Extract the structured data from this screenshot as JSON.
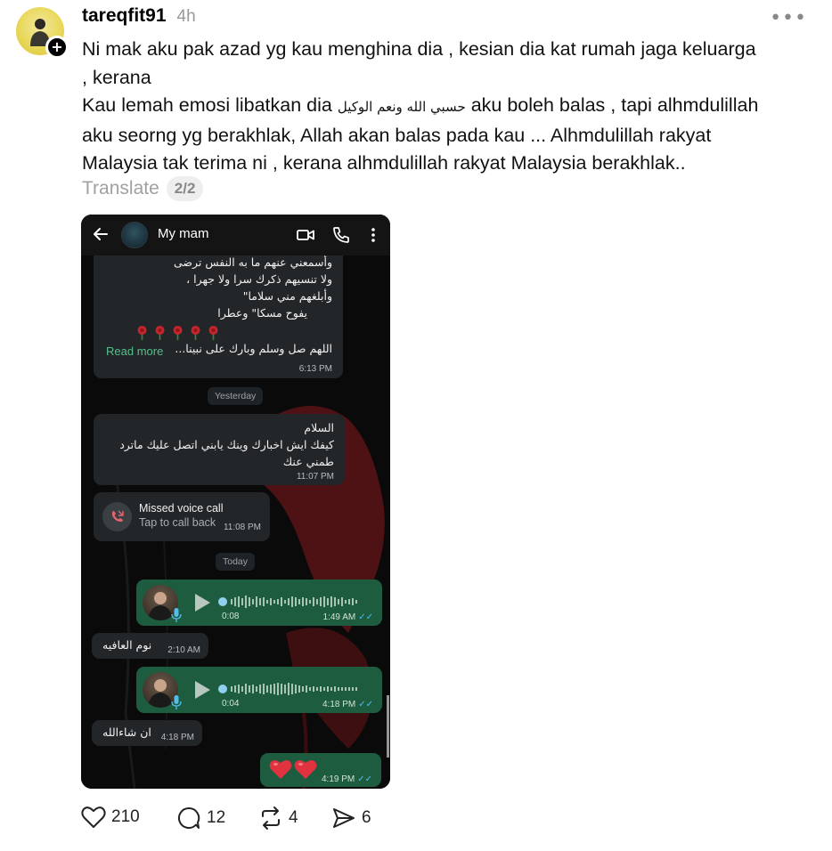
{
  "post": {
    "username": "tareqfit91",
    "time": "4h",
    "more_label": "•••",
    "follow_label": "+",
    "caption": {
      "line1": "Ni mak aku pak azad yg kau menghina dia , kesian dia kat rumah jaga keluarga",
      "line2": ", kerana",
      "line3_start": "Kau lemah emosi libatkan dia ",
      "line3_arabic": "حسبي الله ونعم الوكيل",
      "line3_end": " aku boleh balas , tapi alhmdulillah",
      "line4": "aku seorng yg berakhlak, Allah akan balas pada kau ... Alhmdulillah rakyat",
      "line5": "Malaysia tak terima ni , kerana alhmdulillah rakyat Malaysia berakhlak.."
    },
    "translate_label": "Translate",
    "page_indicator": "2/2"
  },
  "chat": {
    "contact_name": "My mam",
    "messages": {
      "poem_lines": [
        "وأسمعني عنهم ما به النفس ترضى",
        "ولا تنسيهم ذكرك سرا ولا جهرا ،",
        "وأبلغهم  مني  سلاما\"",
        "يفوح مسكا\" وعطرا"
      ],
      "poem_last": "اللهم صل وسلم وبارك على نبينا...",
      "read_more": "Read more",
      "poem_time": "6:13 PM",
      "yesterday_chip": "Yesterday",
      "greeting_lines": [
        "السلام",
        "كيفك ايش اخبارك وينك يابني اتصل عليك ماترد",
        "طمني عنك"
      ],
      "greeting_time": "11:07 PM",
      "call_title": "Missed voice call",
      "call_sub": "Tap to call back",
      "call_time": "11:08 PM",
      "today_chip": "Today",
      "voice1_duration": "0:08",
      "voice1_time": "1:49 AM",
      "reply1": "نوم العافيه",
      "reply1_time": "2:10 AM",
      "voice2_duration": "0:04",
      "voice2_time": "4:18 PM",
      "reply2": "ان شاءالله",
      "reply2_time": "4:18 PM",
      "hearts_time": "4:19 PM",
      "ticks": "✓✓"
    }
  },
  "actions": {
    "likes": "210",
    "comments": "12",
    "reposts": "4",
    "shares": "6"
  },
  "colors": {
    "outgoing_bubble": "#1e5c3f",
    "incoming_bubble": "#232629",
    "read_more": "#53c08b",
    "read_ticks": "#53bdeb"
  }
}
